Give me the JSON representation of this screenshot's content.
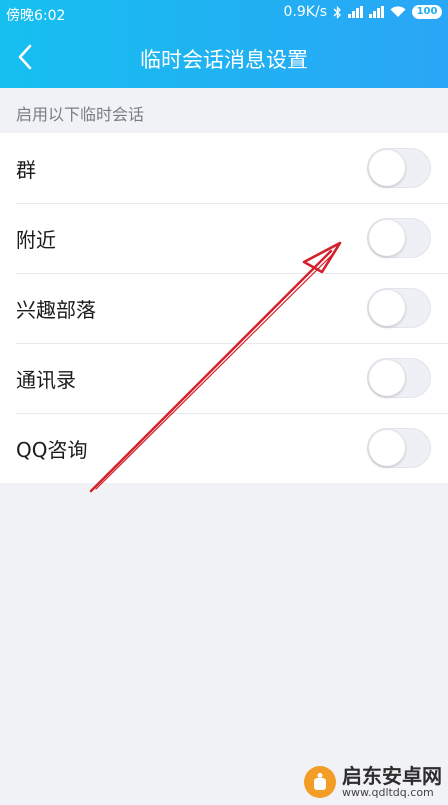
{
  "status_bar": {
    "carrier_time": "傍晚6:02",
    "network_speed": "0.9K/s",
    "battery": "100",
    "icons": [
      "bluetooth-icon",
      "signal-icon",
      "signal-icon",
      "wifi-icon",
      "battery-icon"
    ]
  },
  "header": {
    "title": "临时会话消息设置",
    "back_icon": "chevron-left-icon",
    "background": "#1fb3f2"
  },
  "section": {
    "label": "启用以下临时会话"
  },
  "items": [
    {
      "label": "群",
      "enabled": false
    },
    {
      "label": "附近",
      "enabled": false
    },
    {
      "label": "兴趣部落",
      "enabled": false
    },
    {
      "label": "通讯录",
      "enabled": false
    },
    {
      "label": "QQ咨询",
      "enabled": false
    }
  ],
  "annotation": {
    "type": "red-arrow",
    "color": "#d3202a"
  },
  "watermark": {
    "name": "启东安卓网",
    "url": "www.qdltdq.com"
  }
}
